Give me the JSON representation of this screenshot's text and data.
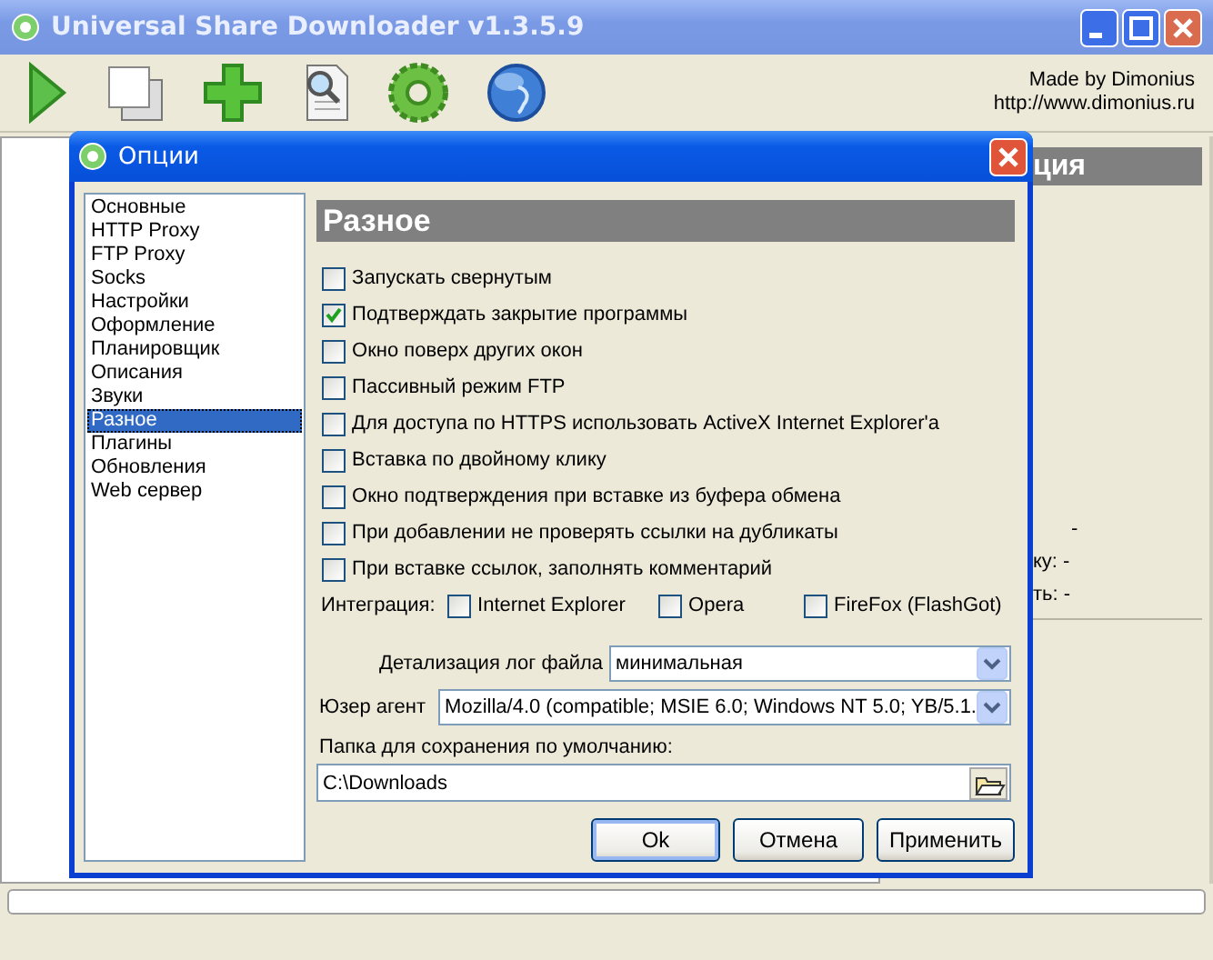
{
  "window": {
    "title": "Universal Share Downloader v1.3.5.9"
  },
  "toolbar": {
    "buttons": [
      {
        "kind": "play"
      },
      {
        "kind": "copy"
      },
      {
        "kind": "add"
      },
      {
        "kind": "search"
      },
      {
        "kind": "gear"
      },
      {
        "kind": "globe"
      }
    ],
    "credits": [
      "Made by Dimonius",
      "http://www.dimonius.ru"
    ]
  },
  "progress": {
    "level": 0
  },
  "info_panel": {
    "header": "ция",
    "lines": [
      "-",
      "ку: -",
      "ть: -"
    ]
  },
  "dialog": {
    "title": "Опции",
    "nav": [
      {
        "label": "Основные",
        "selected": false
      },
      {
        "label": "HTTP Proxy",
        "selected": false
      },
      {
        "label": "FTP Proxy",
        "selected": false
      },
      {
        "label": "Socks",
        "selected": false
      },
      {
        "label": "Настройки",
        "selected": false
      },
      {
        "label": "Оформление",
        "selected": false
      },
      {
        "label": "Планировщик",
        "selected": false
      },
      {
        "label": "Описания",
        "selected": false
      },
      {
        "label": "Звуки",
        "selected": false
      },
      {
        "label": "Разное",
        "selected": true
      },
      {
        "label": "Плагины",
        "selected": false
      },
      {
        "label": "Обновления",
        "selected": false
      },
      {
        "label": "Web сервер",
        "selected": false
      }
    ],
    "section_title": "Разное",
    "options": [
      {
        "label": "Запускать свернутым",
        "checked": false
      },
      {
        "label": "Подтверждать закрытие программы",
        "checked": true
      },
      {
        "label": "Окно поверх других окон",
        "checked": false
      },
      {
        "label": "Пассивный режим FTP",
        "checked": false
      },
      {
        "label": "Для доступа по HTTPS использовать ActiveX Internet Explorer'a",
        "checked": false
      },
      {
        "label": "Вставка по двойному клику",
        "checked": false
      },
      {
        "label": "Окно подтверждения при вставке из буфера обмена",
        "checked": false
      },
      {
        "label": "При добавлении не проверять ссылки на дубликаты",
        "checked": false
      },
      {
        "label": "При вставке ссылок, заполнять комментарий",
        "checked": false
      }
    ],
    "integration": {
      "label": "Интеграция:",
      "options": [
        {
          "label": "Internet Explorer",
          "checked": false
        },
        {
          "label": "Opera",
          "checked": false
        },
        {
          "label": "FireFox (FlashGot)",
          "checked": false
        }
      ]
    },
    "log_detail": {
      "label": "Детализация лог файла",
      "value": "минимальная"
    },
    "user_agent": {
      "label": "Юзер агент",
      "value": "Mozilla/4.0 (compatible; MSIE 6.0; Windows NT 5.0; YB/5.1."
    },
    "folder": {
      "label": "Папка для сохранения по умолчанию:",
      "value": "C:\\Downloads"
    },
    "buttons": [
      {
        "label": "Ok",
        "default": true
      },
      {
        "label": "Отмена",
        "default": false
      },
      {
        "label": "Применить",
        "default": false
      }
    ]
  }
}
